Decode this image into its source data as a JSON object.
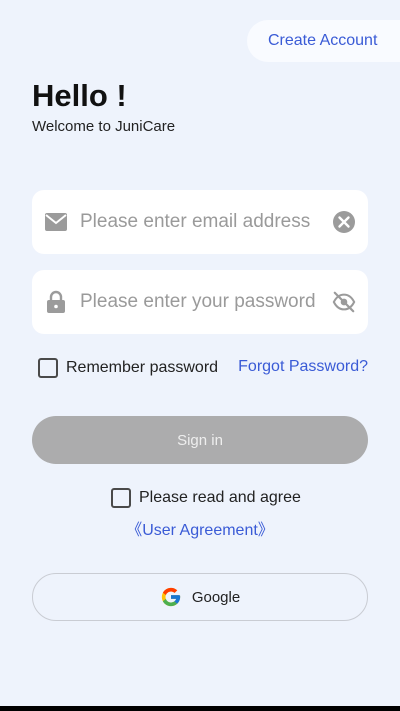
{
  "header": {
    "create_account_label": "Create Account"
  },
  "greeting": {
    "title": "Hello !",
    "subtitle": "Welcome to JuniCare"
  },
  "form": {
    "email": {
      "placeholder": "Please enter email address",
      "value": "",
      "leading_icon": "mail-icon",
      "trailing_icon": "clear-icon"
    },
    "password": {
      "placeholder": "Please enter your password",
      "value": "",
      "leading_icon": "lock-icon",
      "trailing_icon": "eye-off-icon"
    },
    "remember_label": "Remember password",
    "remember_checked": false,
    "forgot_label": "Forgot Password?",
    "signin_label": "Sign in",
    "signin_enabled": false
  },
  "agreement": {
    "label": "Please read and agree",
    "link_label": "《User Agreement》",
    "checked": false
  },
  "social": {
    "google_label": "Google",
    "google_icon": "google-logo-icon"
  },
  "colors": {
    "background": "#eef3fc",
    "accent": "#3a5bd6",
    "button_disabled": "#acacad"
  }
}
